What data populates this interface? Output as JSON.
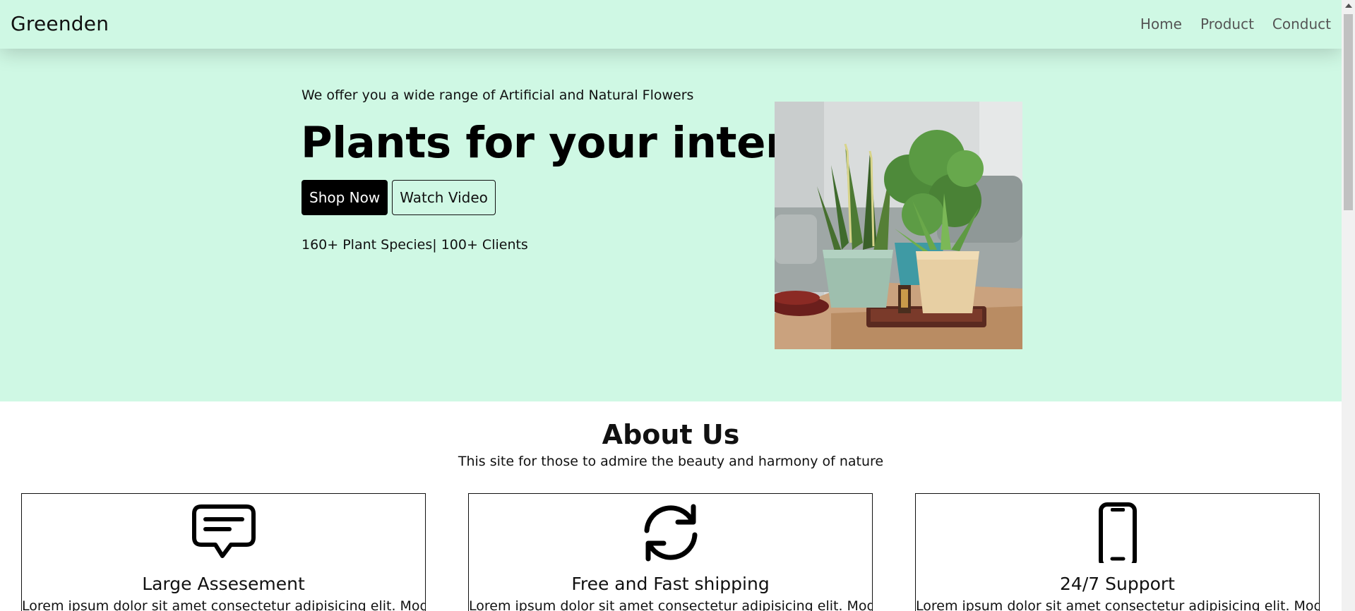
{
  "navbar": {
    "brand": "Greenden",
    "links": [
      "Home",
      "Product",
      "Conduct"
    ]
  },
  "hero": {
    "subtitle": "We offer you a wide range of Artificial and Natural Flowers",
    "title": "Plants for your interior",
    "primary_button": "Shop Now",
    "secondary_button": "Watch Video",
    "stats": "160+ Plant Species| 100+ Clients"
  },
  "about": {
    "title": "About Us",
    "subtitle": "This site for those to admire the beauty and harmony of nature",
    "cards": [
      {
        "icon": "chat-icon",
        "title": "Large Assesement",
        "text": "Lorem ipsum dolor sit amet consectetur adipisicing elit. Modi"
      },
      {
        "icon": "refresh-icon",
        "title": "Free and Fast shipping",
        "text": "Lorem ipsum dolor sit amet consectetur adipisicing elit. Modi"
      },
      {
        "icon": "phone-icon",
        "title": "24/7 Support",
        "text": "Lorem ipsum dolor sit amet consectetur adipisicing elit. Modi"
      }
    ]
  },
  "colors": {
    "hero_background": "#cff8e4",
    "primary_button": "#000000"
  }
}
